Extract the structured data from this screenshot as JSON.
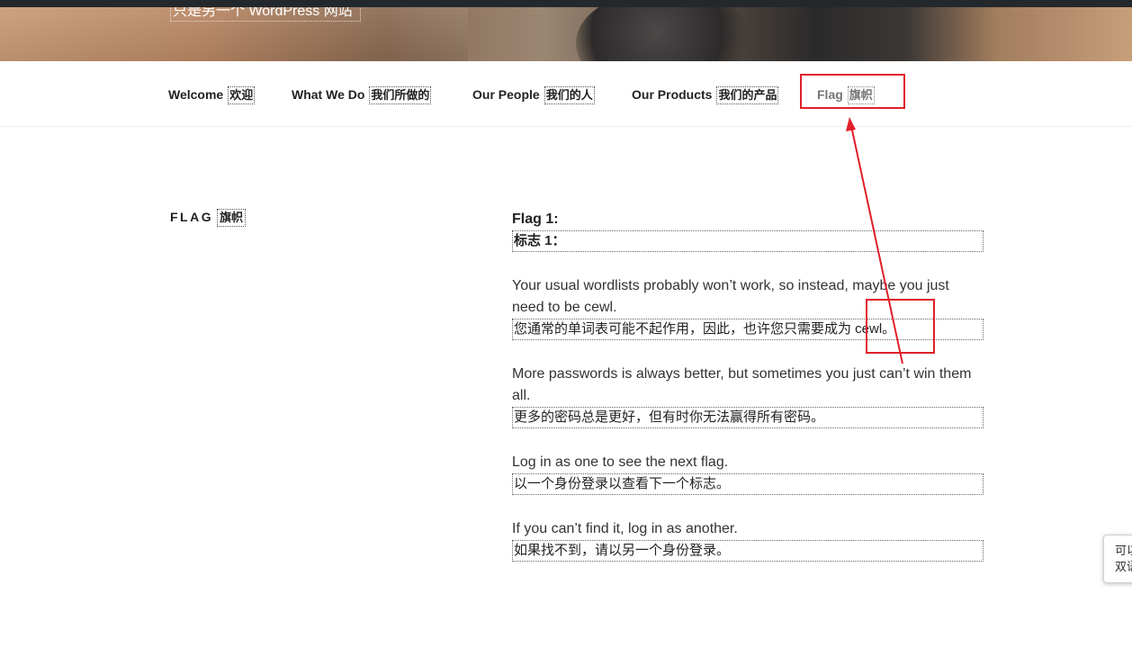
{
  "site": {
    "title": "只是另一个 WordPress 网站"
  },
  "nav": {
    "items": [
      {
        "en": "Welcome",
        "zh": "欢迎"
      },
      {
        "en": "What We Do",
        "zh": "我们所做的"
      },
      {
        "en": "Our People",
        "zh": "我们的人"
      },
      {
        "en": "Our Products",
        "zh": "我们的产品"
      },
      {
        "en": "Flag",
        "zh": "旗帜"
      }
    ]
  },
  "page": {
    "title_en": "FLAG",
    "title_zh": "旗帜"
  },
  "content": {
    "heading_en": "Flag 1:",
    "heading_zh": "标志 1：",
    "paragraphs": [
      {
        "en": "Your usual wordlists probably won’t work, so instead, maybe you just need to be cewl.",
        "zh": "您通常的单词表可能不起作用，因此，也许您只需要成为 cewl。"
      },
      {
        "en": "More passwords is always better, but sometimes you just can’t win them all.",
        "zh": "更多的密码总是更好，但有时你无法赢得所有密码。"
      },
      {
        "en": "Log in as one to see the next flag.",
        "zh": "以一个身份登录以查看下一个标志。"
      },
      {
        "en": "If you can’t find it, log in as another.",
        "zh": "如果找不到，请以另一个身份登录。"
      }
    ]
  },
  "side_popup": {
    "line1": "可以",
    "line2": "双语"
  },
  "colors": {
    "annotation": "#e0202a",
    "nav_current": "#767676"
  }
}
